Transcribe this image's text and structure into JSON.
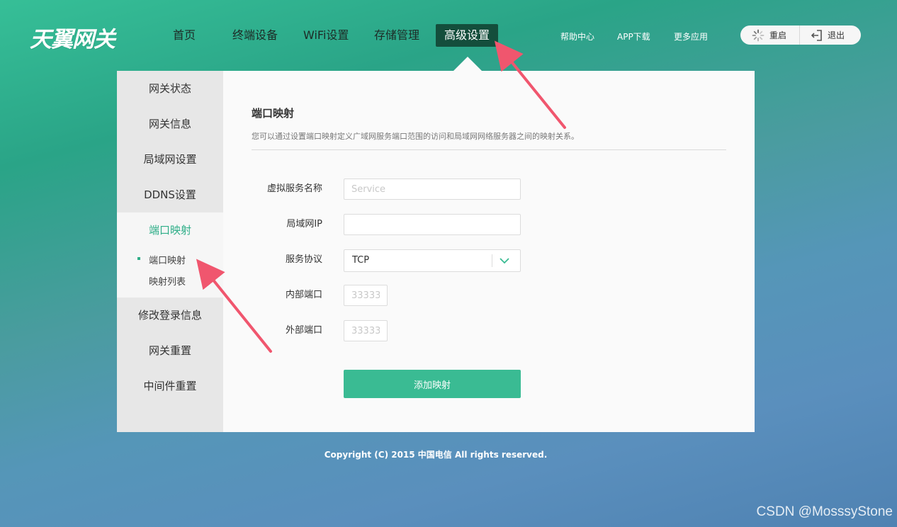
{
  "brand": {
    "logo_text": "天翼网关"
  },
  "nav": {
    "items": [
      {
        "label": "首页"
      },
      {
        "label": "终端设备"
      },
      {
        "label": "WiFi设置"
      },
      {
        "label": "存储管理"
      },
      {
        "label": "高级设置"
      }
    ],
    "active_index": 4
  },
  "top_links": {
    "help": "帮助中心",
    "app": "APP下载",
    "more": "更多应用"
  },
  "actions": {
    "restart": "重启",
    "logout": "退出"
  },
  "sidebar": {
    "items": [
      {
        "label": "网关状态"
      },
      {
        "label": "网关信息"
      },
      {
        "label": "局域网设置"
      },
      {
        "label": "DDNS设置"
      },
      {
        "label": "端口映射"
      },
      {
        "label": "修改登录信息"
      },
      {
        "label": "网关重置"
      },
      {
        "label": "中间件重置"
      }
    ],
    "active_index": 4,
    "sub_items": [
      {
        "label": "端口映射"
      },
      {
        "label": "映射列表"
      }
    ],
    "active_sub_index": 0
  },
  "main": {
    "title": "端口映射",
    "description": "您可以通过设置端口映射定义广域网服务端口范围的访问和局域网网络服务器之间的映射关系。",
    "form": {
      "service_name": {
        "label": "虚拟服务名称",
        "value": "",
        "placeholder": "Service"
      },
      "lan_ip": {
        "label": "局域网IP",
        "value": "",
        "placeholder": ""
      },
      "protocol": {
        "label": "服务协议",
        "value": "TCP"
      },
      "internal_port": {
        "label": "内部端口",
        "value": "",
        "placeholder": "33333"
      },
      "external_port": {
        "label": "外部端口",
        "value": "",
        "placeholder": "33333"
      }
    },
    "submit_label": "添加映射"
  },
  "footer": {
    "copyright": "Copyright (C) 2015 中国电信 All rights reserved."
  },
  "watermark": "CSDN @MosssyStone",
  "colors": {
    "accent": "#3abb93",
    "nav_active_bg": "#144e3c",
    "sidebar_active_text": "#2fae88",
    "annotation_arrow": "#f0566e"
  }
}
